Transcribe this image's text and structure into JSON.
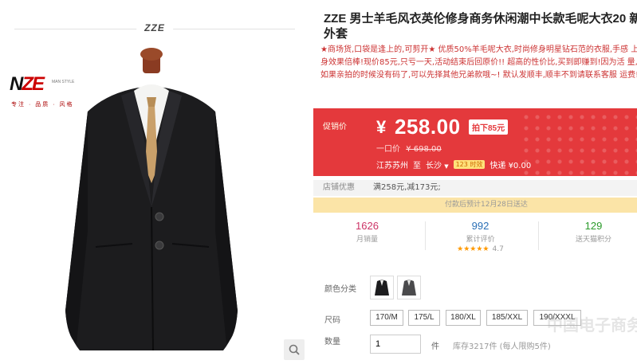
{
  "gallery": {
    "brand_top": "ZZE",
    "logo_text_left": "N",
    "logo_text_right": "ZE",
    "logo_tagline": "专注 · 品质 · 风格",
    "logo_side": "MAN STYLE"
  },
  "product": {
    "title": "ZZE 男士羊毛风衣英伦修身商务休闲潮中长款毛呢大衣20 新款外套",
    "description": "★商场货,口袋是逢上的,可剪开★ 优质50%羊毛呢大衣,时尚修身明星钻石范的衣服,手感 上身效果倍棒!现价85元,只亏一天,活动结束后回原价!! 超高的性价比,买到即赚到!因为活 量,如果亲拍的时候没有码了,可以先择其他兄弟款哦~! 默认发顺丰,顺丰不到请联系客服 运费!"
  },
  "price": {
    "label": "促销价",
    "currency": "¥",
    "value": "258.00",
    "discount_tag": "拍下85元",
    "orig_label": "一口价",
    "orig_value": "¥ 698.00",
    "ship_from": "江苏苏州",
    "ship_to_label": "至",
    "ship_to": "长沙",
    "ship_badge": "123 时效",
    "ship_fee": "快递 ¥0.00"
  },
  "promo": {
    "label": "店铺优惠",
    "value": "满258元,减173元;"
  },
  "delivery_note": "付款后预计12月28日送达",
  "stats": {
    "monthly_sales": "1626",
    "monthly_sales_label": "月销量",
    "reviews": "992",
    "reviews_label": "累计评价",
    "rating_stars": "★★★★★",
    "rating": "4.7",
    "points": "129",
    "points_label": "送天猫积分"
  },
  "options": {
    "color_label": "颜色分类",
    "size_label": "尺码",
    "sizes": [
      "170/M",
      "175/L",
      "180/XL",
      "185/XXL",
      "190/XXXL"
    ],
    "qty_label": "数量",
    "qty_value": "1",
    "qty_unit": "件",
    "stock_text": "库存3217件 (每人限购5件)"
  },
  "watermark": "中国电子商务 找卖家",
  "colors": {
    "accent": "#e4393c",
    "stats_green": "#2a9a2a",
    "stats_orange": "#c36",
    "stats_blue": "#2a6fb5"
  }
}
